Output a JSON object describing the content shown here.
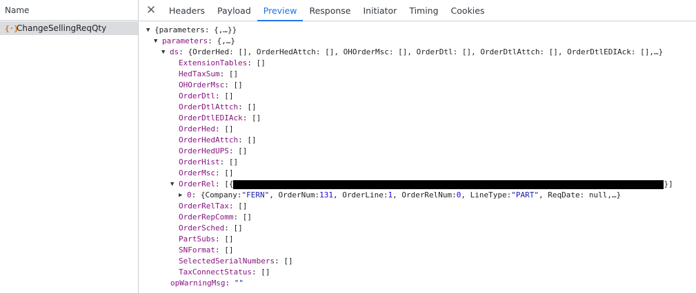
{
  "left_panel": {
    "column_header": "Name",
    "request": {
      "icon": "{·}",
      "name": "ChangeSellingReqQty"
    }
  },
  "tabs": {
    "close": "✕",
    "items": [
      "Headers",
      "Payload",
      "Preview",
      "Response",
      "Initiator",
      "Timing",
      "Cookies"
    ],
    "active": "Preview"
  },
  "preview": {
    "root": {
      "key": "{parameters: {,…}}"
    },
    "parameters": {
      "key": "parameters",
      "summary": "{,…}"
    },
    "ds": {
      "key": "ds",
      "summary": "{OrderHed: [], OrderHedAttch: [], OHOrderMsc: [], OrderDtl: [], OrderDtlAttch: [], OrderDtlEDIAck: [],…}"
    },
    "tables_a": [
      {
        "key": "ExtensionTables",
        "value": "[]"
      },
      {
        "key": "HedTaxSum",
        "value": "[]"
      },
      {
        "key": "OHOrderMsc",
        "value": "[]"
      },
      {
        "key": "OrderDtl",
        "value": "[]"
      },
      {
        "key": "OrderDtlAttch",
        "value": "[]"
      },
      {
        "key": "OrderDtlEDIAck",
        "value": "[]"
      },
      {
        "key": "OrderHed",
        "value": "[]"
      },
      {
        "key": "OrderHedAttch",
        "value": "[]"
      },
      {
        "key": "OrderHedUPS",
        "value": "[]"
      },
      {
        "key": "OrderHist",
        "value": "[]"
      },
      {
        "key": "OrderMsc",
        "value": "[]"
      }
    ],
    "orderrel": {
      "key": "OrderRel",
      "open": "[{",
      "close": "}]"
    },
    "orderrel_item": {
      "index": "0",
      "text_a": "{Company: ",
      "company": "\"FERN\"",
      "text_b": ", OrderNum: ",
      "ordernum": "131",
      "text_c": ", OrderLine: ",
      "orderline": "1",
      "text_d": ", OrderRelNum: ",
      "orderrelnum": "0",
      "text_e": ", LineType: ",
      "linetype": "\"PART\"",
      "text_f": ", ReqDate: null,…}"
    },
    "tables_b": [
      {
        "key": "OrderRelTax",
        "value": "[]"
      },
      {
        "key": "OrderRepComm",
        "value": "[]"
      },
      {
        "key": "OrderSched",
        "value": "[]"
      },
      {
        "key": "PartSubs",
        "value": "[]"
      },
      {
        "key": "SNFormat",
        "value": "[]"
      },
      {
        "key": "SelectedSerialNumbers",
        "value": "[]"
      },
      {
        "key": "TaxConnectStatus",
        "value": "[]"
      }
    ],
    "warning": {
      "key": "opWarningMsg",
      "value": "\"\""
    }
  },
  "icons": {
    "expanded": "triangle-down-icon",
    "collapsed": "triangle-right-icon"
  }
}
